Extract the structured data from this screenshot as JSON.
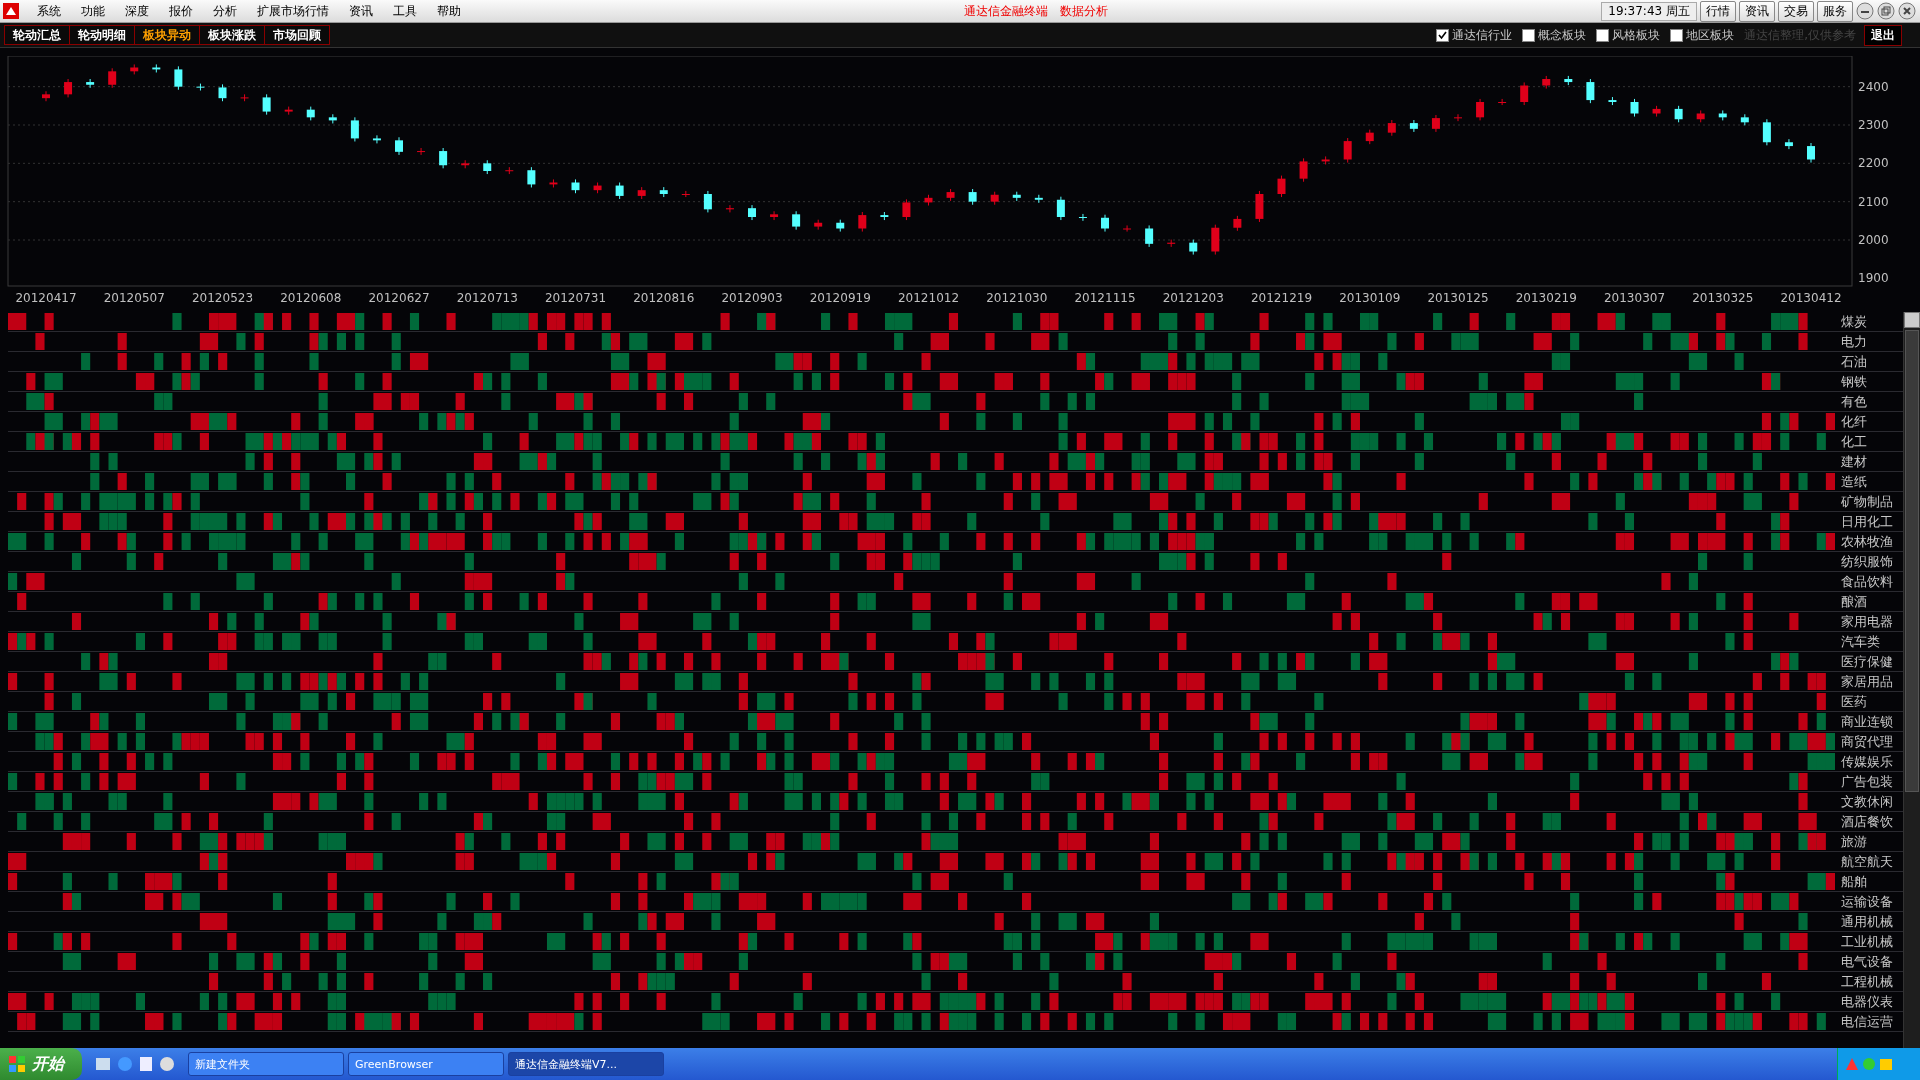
{
  "menu": {
    "items": [
      "系统",
      "功能",
      "深度",
      "报价",
      "分析",
      "扩展市场行情",
      "资讯",
      "工具",
      "帮助"
    ],
    "title_parts": [
      "通达信金融终端",
      "数据分析"
    ],
    "clock": "19:37:43 周五",
    "buttons": [
      "行情",
      "资讯",
      "交易",
      "服务"
    ]
  },
  "tabs": [
    {
      "label": "轮动汇总",
      "selected": false
    },
    {
      "label": "轮动明细",
      "selected": false
    },
    {
      "label": "板块异动",
      "selected": true
    },
    {
      "label": "板块涨跌",
      "selected": false
    },
    {
      "label": "市场回顾",
      "selected": false
    }
  ],
  "filters": [
    {
      "label": "通达信行业",
      "checked": true
    },
    {
      "label": "概念板块",
      "checked": false
    },
    {
      "label": "风格板块",
      "checked": false
    },
    {
      "label": "地区板块",
      "checked": false
    }
  ],
  "note": "通达信整理,仅供参考",
  "exit_button": "退出",
  "chart_data": {
    "type": "candlestick",
    "grid": true,
    "categories": [
      "20120417",
      null,
      null,
      null,
      "20120507",
      null,
      null,
      null,
      "20120523",
      null,
      null,
      null,
      "20120608",
      null,
      null,
      null,
      "20120627",
      null,
      null,
      null,
      "20120713",
      null,
      null,
      null,
      "20120731",
      null,
      null,
      null,
      "20120816",
      null,
      null,
      null,
      "20120903",
      null,
      null,
      null,
      "20120919",
      null,
      null,
      null,
      "20121012",
      null,
      null,
      null,
      "20121030",
      null,
      null,
      null,
      "20121115",
      null,
      null,
      null,
      "20121203",
      null,
      null,
      null,
      "20121219",
      null,
      null,
      null,
      "20130109",
      null,
      null,
      null,
      "20130125",
      null,
      null,
      null,
      "20130219",
      null,
      null,
      null,
      "20130307",
      null,
      null,
      null,
      "20130325",
      null,
      null,
      null,
      "20130412"
    ],
    "ohlc": [
      [
        2370,
        2388,
        2362,
        2380
      ],
      [
        2380,
        2420,
        2372,
        2412
      ],
      [
        2412,
        2420,
        2397,
        2405
      ],
      [
        2405,
        2448,
        2397,
        2440
      ],
      [
        2440,
        2458,
        2432,
        2450
      ],
      [
        2450,
        2458,
        2437,
        2445
      ],
      [
        2445,
        2453,
        2392,
        2400
      ],
      [
        2400,
        2408,
        2390,
        2398
      ],
      [
        2398,
        2406,
        2362,
        2370
      ],
      [
        2370,
        2380,
        2362,
        2372
      ],
      [
        2372,
        2380,
        2327,
        2335
      ],
      [
        2335,
        2348,
        2327,
        2340
      ],
      [
        2340,
        2348,
        2312,
        2320
      ],
      [
        2320,
        2328,
        2304,
        2312
      ],
      [
        2312,
        2320,
        2257,
        2265
      ],
      [
        2265,
        2273,
        2252,
        2260
      ],
      [
        2260,
        2268,
        2222,
        2230
      ],
      [
        2230,
        2240,
        2222,
        2232
      ],
      [
        2232,
        2240,
        2187,
        2195
      ],
      [
        2195,
        2208,
        2187,
        2200
      ],
      [
        2200,
        2208,
        2172,
        2180
      ],
      [
        2180,
        2190,
        2172,
        2182
      ],
      [
        2182,
        2190,
        2137,
        2145
      ],
      [
        2145,
        2158,
        2137,
        2150
      ],
      [
        2150,
        2158,
        2122,
        2130
      ],
      [
        2130,
        2150,
        2122,
        2142
      ],
      [
        2142,
        2150,
        2107,
        2115
      ],
      [
        2115,
        2138,
        2107,
        2130
      ],
      [
        2130,
        2138,
        2112,
        2120
      ],
      [
        2120,
        2128,
        2112,
        2120
      ],
      [
        2120,
        2128,
        2072,
        2080
      ],
      [
        2080,
        2091,
        2072,
        2083
      ],
      [
        2083,
        2091,
        2052,
        2060
      ],
      [
        2060,
        2075,
        2052,
        2067
      ],
      [
        2067,
        2075,
        2027,
        2035
      ],
      [
        2035,
        2053,
        2027,
        2045
      ],
      [
        2045,
        2053,
        2022,
        2030
      ],
      [
        2030,
        2073,
        2022,
        2065
      ],
      [
        2065,
        2073,
        2052,
        2060
      ],
      [
        2060,
        2106,
        2052,
        2098
      ],
      [
        2098,
        2118,
        2090,
        2110
      ],
      [
        2110,
        2133,
        2102,
        2125
      ],
      [
        2125,
        2133,
        2092,
        2100
      ],
      [
        2100,
        2126,
        2092,
        2118
      ],
      [
        2118,
        2126,
        2102,
        2110
      ],
      [
        2110,
        2118,
        2097,
        2105
      ],
      [
        2105,
        2113,
        2052,
        2060
      ],
      [
        2060,
        2068,
        2050,
        2058
      ],
      [
        2058,
        2066,
        2022,
        2030
      ],
      [
        2030,
        2038,
        2022,
        2030
      ],
      [
        2030,
        2038,
        1982,
        1990
      ],
      [
        1990,
        2001,
        1982,
        1993
      ],
      [
        1993,
        2001,
        1962,
        1970
      ],
      [
        1970,
        2040,
        1962,
        2032
      ],
      [
        2032,
        2063,
        2024,
        2055
      ],
      [
        2055,
        2128,
        2047,
        2120
      ],
      [
        2120,
        2168,
        2112,
        2160
      ],
      [
        2160,
        2213,
        2152,
        2205
      ],
      [
        2205,
        2218,
        2197,
        2210
      ],
      [
        2210,
        2266,
        2202,
        2258
      ],
      [
        2258,
        2288,
        2250,
        2280
      ],
      [
        2280,
        2313,
        2272,
        2305
      ],
      [
        2305,
        2313,
        2282,
        2290
      ],
      [
        2290,
        2326,
        2282,
        2318
      ],
      [
        2318,
        2328,
        2310,
        2320
      ],
      [
        2320,
        2368,
        2312,
        2360
      ],
      [
        2360,
        2368,
        2352,
        2360
      ],
      [
        2360,
        2411,
        2352,
        2403
      ],
      [
        2403,
        2428,
        2395,
        2420
      ],
      [
        2420,
        2428,
        2404,
        2412
      ],
      [
        2412,
        2420,
        2357,
        2365
      ],
      [
        2365,
        2373,
        2352,
        2360
      ],
      [
        2360,
        2368,
        2322,
        2330
      ],
      [
        2330,
        2350,
        2322,
        2342
      ],
      [
        2342,
        2350,
        2307,
        2315
      ],
      [
        2315,
        2338,
        2307,
        2330
      ],
      [
        2330,
        2338,
        2312,
        2320
      ],
      [
        2320,
        2328,
        2299,
        2307
      ],
      [
        2307,
        2315,
        2247,
        2255
      ],
      [
        2255,
        2263,
        2237,
        2245
      ],
      [
        2245,
        2253,
        2202,
        2210
      ]
    ],
    "ylim": [
      1880,
      2480
    ],
    "yticks": [
      1900,
      2000,
      2100,
      2200,
      2300,
      2400
    ]
  },
  "sectors": [
    {
      "name": "煤炭"
    },
    {
      "name": "电力"
    },
    {
      "name": "石油"
    },
    {
      "name": "钢铁"
    },
    {
      "name": "有色"
    },
    {
      "name": "化纤"
    },
    {
      "name": "化工"
    },
    {
      "name": "建材"
    },
    {
      "name": "造纸"
    },
    {
      "name": "矿物制品"
    },
    {
      "name": "日用化工"
    },
    {
      "name": "农林牧渔"
    },
    {
      "name": "纺织服饰"
    },
    {
      "name": "食品饮料"
    },
    {
      "name": "酿酒"
    },
    {
      "name": "家用电器"
    },
    {
      "name": "汽车类"
    },
    {
      "name": "医疗保健"
    },
    {
      "name": "家居用品"
    },
    {
      "name": "医药"
    },
    {
      "name": "商业连锁"
    },
    {
      "name": "商贸代理"
    },
    {
      "name": "传媒娱乐"
    },
    {
      "name": "广告包装"
    },
    {
      "name": "文教休闲"
    },
    {
      "name": "酒店餐饮"
    },
    {
      "name": "旅游"
    },
    {
      "name": "航空航天"
    },
    {
      "name": "船舶"
    },
    {
      "name": "运输设备"
    },
    {
      "name": "通用机械"
    },
    {
      "name": "工业机械"
    },
    {
      "name": "电气设备"
    },
    {
      "name": "工程机械"
    },
    {
      "name": "电器仪表"
    },
    {
      "name": "电信运营"
    }
  ],
  "taskbar": {
    "start": "开始",
    "tasks": [
      {
        "label": "新建文件夹",
        "selected": false
      },
      {
        "label": "GreenBrowser",
        "selected": false
      },
      {
        "label": "通达信金融终端V7...",
        "selected": true
      }
    ]
  }
}
